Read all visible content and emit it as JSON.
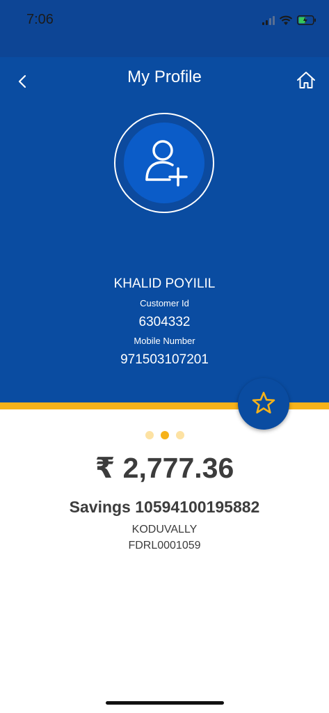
{
  "status_bar": {
    "time": "7:06"
  },
  "header": {
    "title": "My Profile",
    "back_icon": "chevron-left-icon",
    "home_icon": "home-icon"
  },
  "profile": {
    "avatar_icon": "add-user-icon",
    "name": "KHALID POYILIL",
    "customer_id_label": "Customer Id",
    "customer_id": "6304332",
    "mobile_label": "Mobile Number",
    "mobile": "971503107201"
  },
  "favorite_icon": "star-icon",
  "carousel": {
    "pages": 3,
    "active_index": 1
  },
  "account": {
    "balance": "₹ 2,777.36",
    "type": "Savings",
    "number": "10594100195882",
    "branch": "KODUVALLY",
    "ifsc": "FDRL0001059"
  },
  "colors": {
    "primary_blue": "#0a4ca1",
    "accent_yellow": "#f6b21a",
    "text_dark": "#3c3c3c"
  }
}
